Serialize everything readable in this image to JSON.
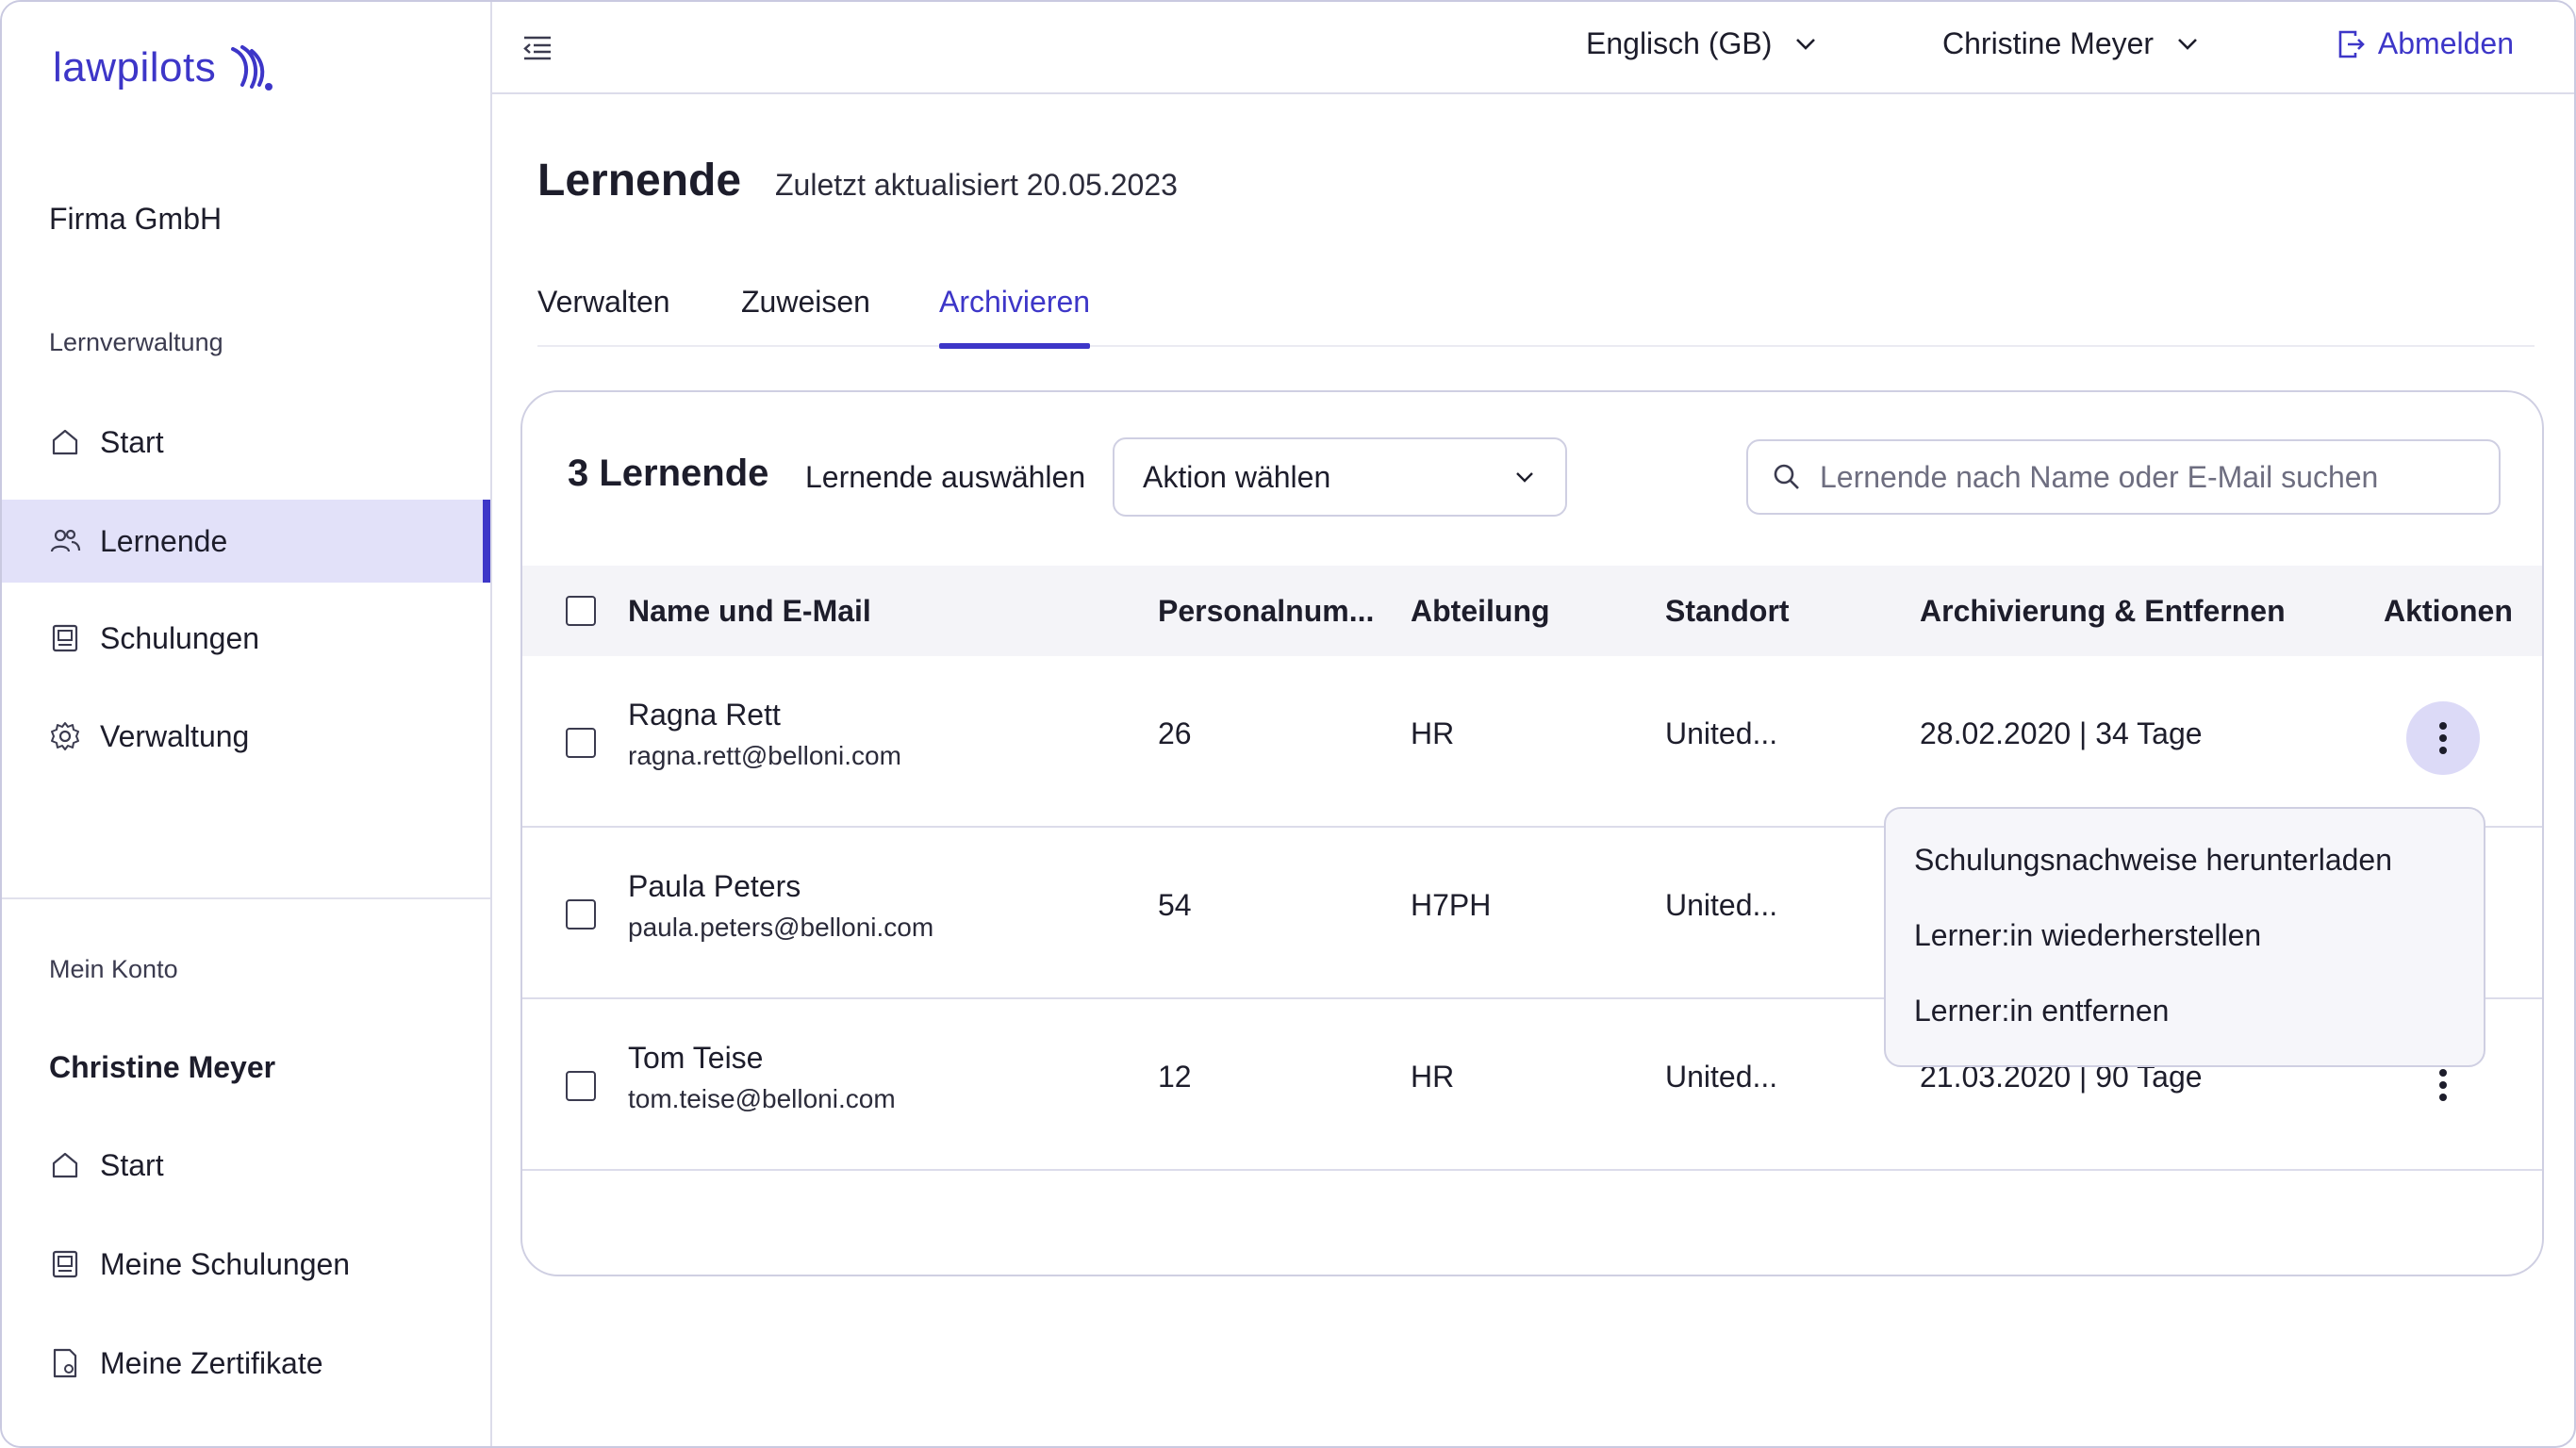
{
  "brand": {
    "name": "lawpilots",
    "color": "#3d36c8"
  },
  "sidebar": {
    "company": "Firma GmbH",
    "section_learning": "Lernverwaltung",
    "items": [
      {
        "label": "Start",
        "icon": "home-icon"
      },
      {
        "label": "Lernende",
        "icon": "users-icon",
        "active": true
      },
      {
        "label": "Schulungen",
        "icon": "training-icon"
      },
      {
        "label": "Verwaltung",
        "icon": "gear-icon"
      }
    ],
    "section_account": "Mein Konto",
    "account_name": "Christine Meyer",
    "account_items": [
      {
        "label": "Start",
        "icon": "home-icon"
      },
      {
        "label": "Meine Schulungen",
        "icon": "training-icon"
      },
      {
        "label": "Meine Zertifikate",
        "icon": "certificate-icon"
      }
    ]
  },
  "topbar": {
    "language": "Englisch (GB)",
    "user": "Christine Meyer",
    "logout": "Abmelden"
  },
  "page": {
    "title": "Lernende",
    "updated": "Zuletzt aktualisiert 20.05.2023",
    "tabs": [
      {
        "label": "Verwalten"
      },
      {
        "label": "Zuweisen"
      },
      {
        "label": "Archivieren",
        "active": true
      }
    ]
  },
  "table": {
    "count": "3 Lernende",
    "select_label": "Lernende auswählen",
    "action_select": "Aktion wählen",
    "search_placeholder": "Lernende nach Name oder E-Mail suchen",
    "headers": {
      "name": "Name und E-Mail",
      "personal": "Personalnum...",
      "department": "Abteilung",
      "location": "Standort",
      "archive": "Archivierung & Entfernen",
      "actions": "Aktionen"
    },
    "rows": [
      {
        "name": "Ragna Rett",
        "email": "ragna.rett@belloni.com",
        "number": "26",
        "department": "HR",
        "location": "United...",
        "archive": "28.02.2020 | 34 Tage"
      },
      {
        "name": "Paula Peters",
        "email": "paula.peters@belloni.com",
        "number": "54",
        "department": "H7PH",
        "location": "United...",
        "archive": ""
      },
      {
        "name": "Tom Teise",
        "email": "tom.teise@belloni.com",
        "number": "12",
        "department": "HR",
        "location": "United...",
        "archive": "21.03.2020 | 90 Tage"
      }
    ]
  },
  "row_menu": {
    "items": [
      "Schulungsnachweise herunterladen",
      "Lerner:in wiederherstellen",
      "Lerner:in entfernen"
    ]
  }
}
